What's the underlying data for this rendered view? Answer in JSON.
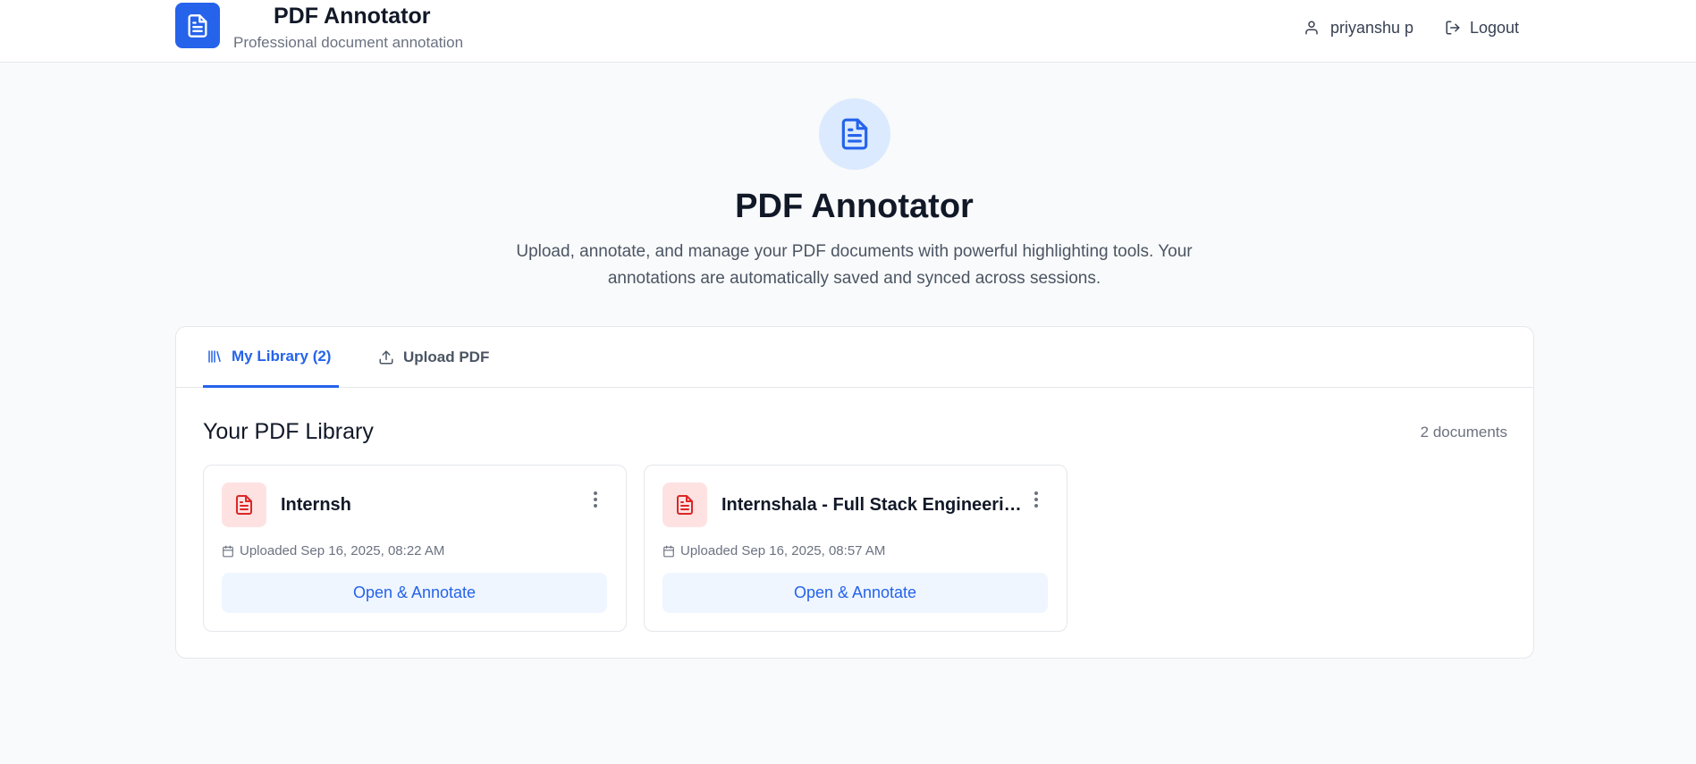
{
  "header": {
    "app_title": "PDF Annotator",
    "app_subtitle": "Professional document annotation",
    "user_name": "priyanshu p",
    "logout_label": "Logout"
  },
  "hero": {
    "title": "PDF Annotator",
    "description": "Upload, annotate, and manage your PDF documents with powerful highlighting tools. Your annotations are automatically saved and synced across sessions."
  },
  "tabs": [
    {
      "label": "My Library (2)",
      "icon": "library-icon",
      "active": true
    },
    {
      "label": "Upload PDF",
      "icon": "upload-icon",
      "active": false
    }
  ],
  "library": {
    "title": "Your PDF Library",
    "count_label": "2 documents",
    "documents": [
      {
        "name": "Internsh",
        "uploaded": "Uploaded Sep 16, 2025, 08:22 AM",
        "action": "Open & Annotate"
      },
      {
        "name": "Internshala - Full Stack Engineering...",
        "uploaded": "Uploaded Sep 16, 2025, 08:57 AM",
        "action": "Open & Annotate"
      }
    ]
  },
  "colors": {
    "accent": "#2563eb",
    "accent_light": "#dbeafe",
    "file_icon": "#dc2626",
    "file_tile": "#fee2e2",
    "button_bg": "#eff6ff",
    "page_bg": "#f9fafb"
  }
}
